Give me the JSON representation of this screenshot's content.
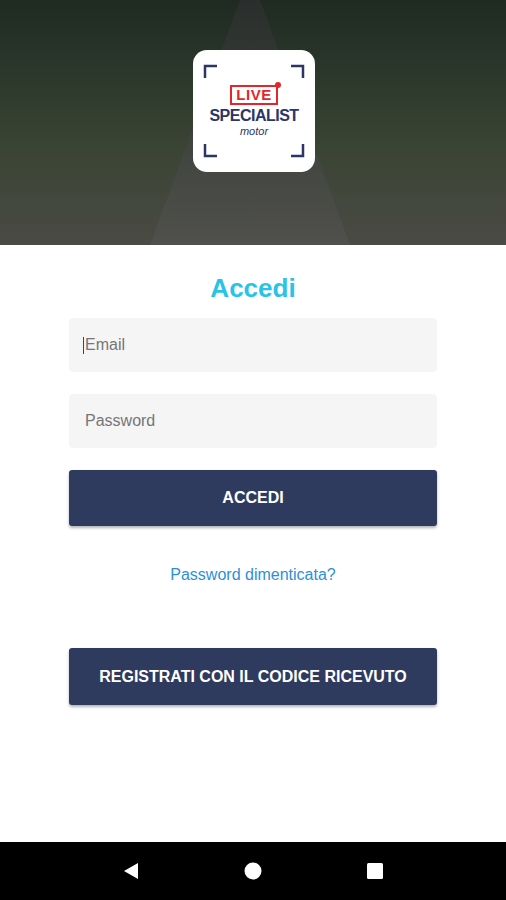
{
  "logo": {
    "live": "LIVE",
    "title": "SPECIALIST",
    "subtitle": "motor"
  },
  "heading": "Accedi",
  "fields": [
    {
      "placeholder": "Email",
      "focused": true,
      "kind": "email"
    },
    {
      "placeholder": "Password",
      "focused": false,
      "kind": "password"
    }
  ],
  "login_button": "ACCEDI",
  "forgot_link": "Password dimenticata?",
  "register_button": "REGISTRATI CON IL CODICE RICEVUTO"
}
